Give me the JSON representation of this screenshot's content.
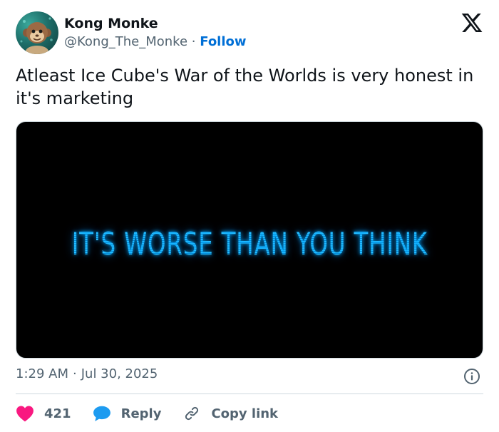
{
  "author": {
    "name": "Kong Monke",
    "handle": "@Kong_The_Monke",
    "separator": "·",
    "follow_label": "Follow"
  },
  "tweet": {
    "text": "Atleast Ice Cube's War of the Worlds is very honest in it's marketing",
    "media_text": "IT'S WORSE THAN YOU THINK"
  },
  "meta": {
    "time": "1:29 AM",
    "separator": "·",
    "date": "Jul 30, 2025"
  },
  "actions": {
    "like_count": "421",
    "reply_label": "Reply",
    "copy_label": "Copy link"
  },
  "colors": {
    "follow": "#006fd6",
    "like": "#f91880",
    "reply": "#1d9bf0",
    "media_glow": "#22b8ff"
  },
  "icons": {
    "logo": "x-logo-icon",
    "info": "info-icon",
    "like": "heart-icon",
    "reply": "speech-bubble-icon",
    "copy": "link-icon"
  }
}
